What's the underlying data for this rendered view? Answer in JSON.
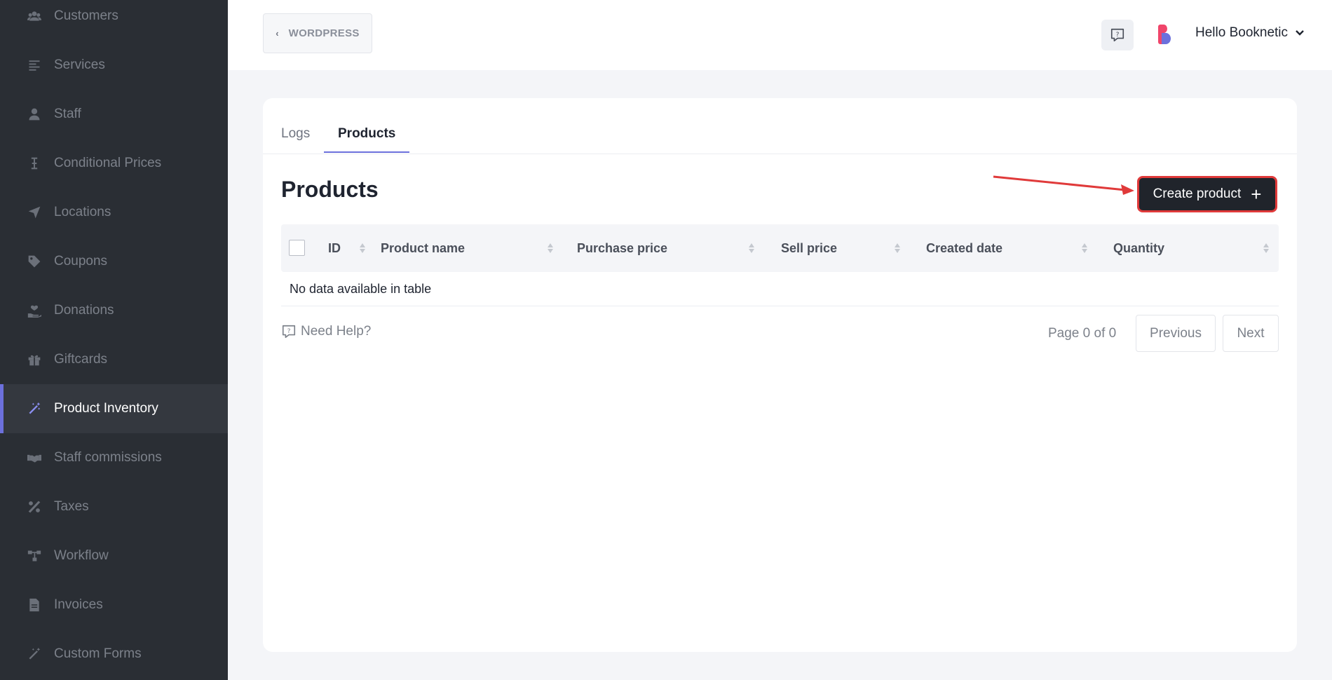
{
  "sidebar": {
    "items": [
      {
        "label": "Customers",
        "icon": "users-icon"
      },
      {
        "label": "Services",
        "icon": "list-icon"
      },
      {
        "label": "Staff",
        "icon": "user-icon"
      },
      {
        "label": "Conditional Prices",
        "icon": "text-cursor-icon"
      },
      {
        "label": "Locations",
        "icon": "location-arrow-icon"
      },
      {
        "label": "Coupons",
        "icon": "tag-icon"
      },
      {
        "label": "Donations",
        "icon": "hand-heart-icon"
      },
      {
        "label": "Giftcards",
        "icon": "gift-icon"
      },
      {
        "label": "Product Inventory",
        "icon": "magic-wand-icon",
        "active": true
      },
      {
        "label": "Staff commissions",
        "icon": "handshake-icon"
      },
      {
        "label": "Taxes",
        "icon": "percent-icon"
      },
      {
        "label": "Workflow",
        "icon": "workflow-icon"
      },
      {
        "label": "Invoices",
        "icon": "file-icon"
      },
      {
        "label": "Custom Forms",
        "icon": "magic-wand-icon"
      }
    ]
  },
  "topbar": {
    "back_label": "WORDPRESS",
    "user_name": "Hello Booknetic"
  },
  "tabs": {
    "logs": "Logs",
    "products": "Products"
  },
  "main": {
    "title": "Products",
    "create_label": "Create product",
    "columns": [
      "ID",
      "Product name",
      "Purchase price",
      "Sell price",
      "Created date",
      "Quantity"
    ],
    "empty_text": "No data available in table",
    "need_help": "Need Help?",
    "page_info": "Page 0 of 0",
    "prev_label": "Previous",
    "next_label": "Next"
  },
  "colors": {
    "sidebar_bg": "#2a2e34",
    "accent": "#6c70dc",
    "annotation": "#e03a3a"
  }
}
